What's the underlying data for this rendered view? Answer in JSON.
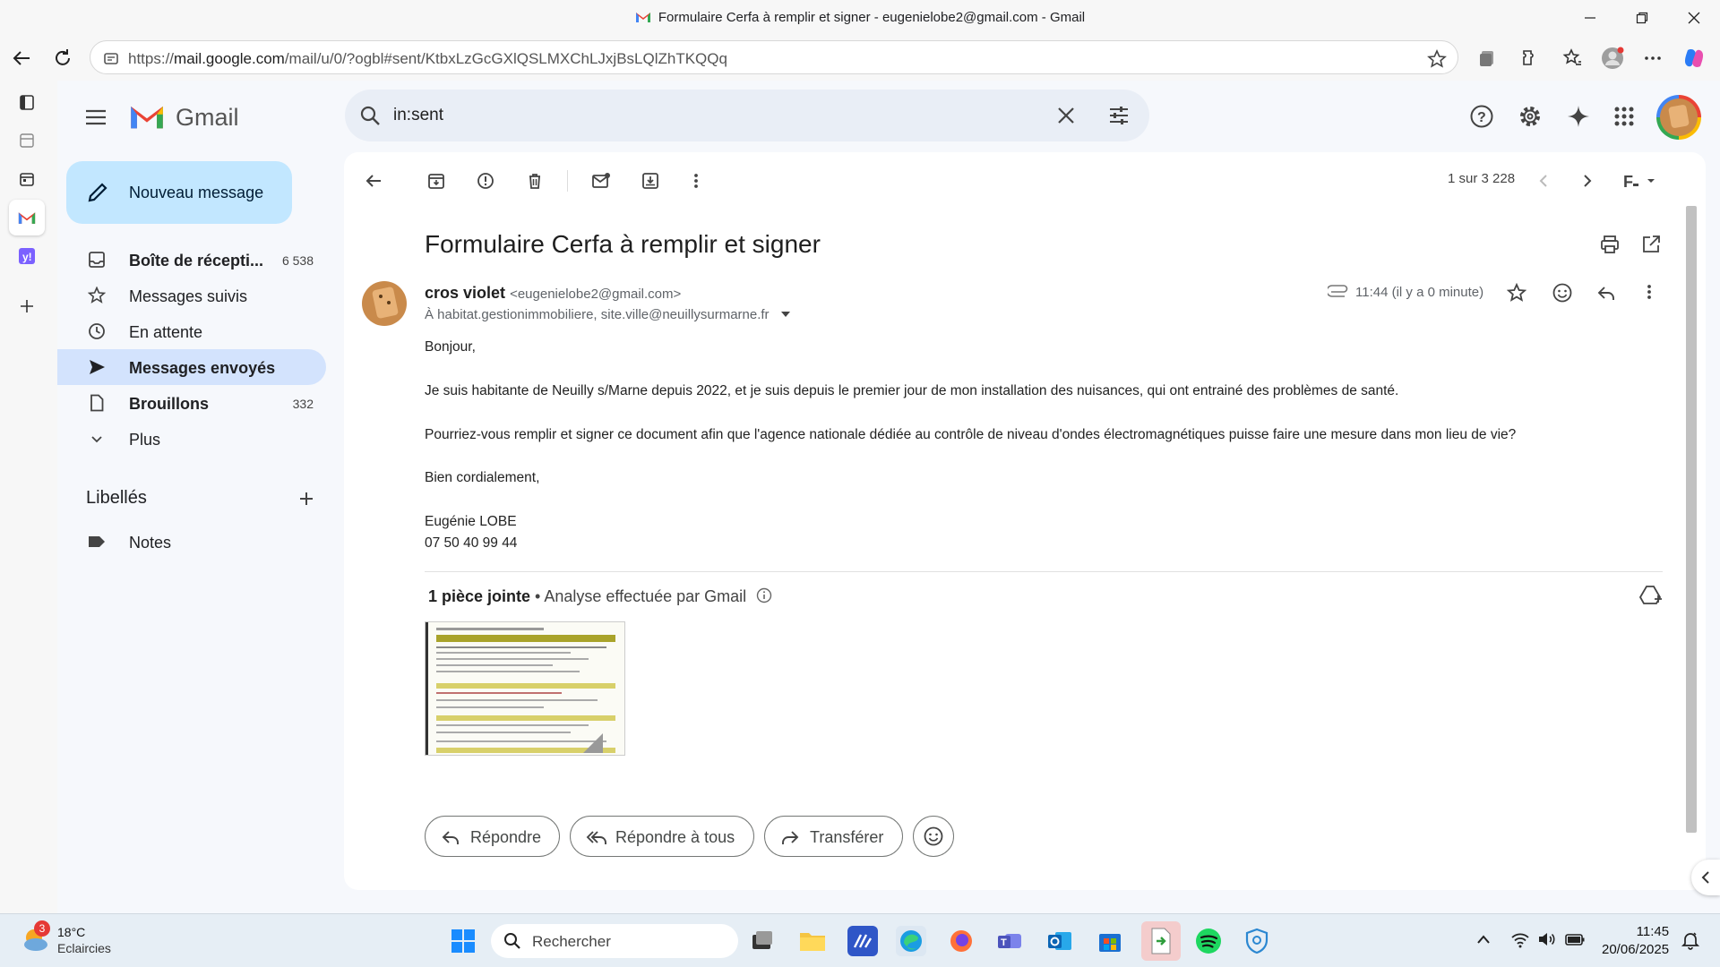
{
  "browser": {
    "window_title": "Formulaire Cerfa à remplir et signer - eugenielobe2@gmail.com - Gmail",
    "url_prefix": "https://",
    "url_domain": "mail.google.com",
    "url_rest": "/mail/u/0/?ogbl#sent/KtbxLzGcGXlQSLMXChLJxjBsLQlZhTKQQq"
  },
  "gmail": {
    "logo_text": "Gmail",
    "search_query": "in:sent",
    "compose_label": "Nouveau message",
    "nav": [
      {
        "label": "Boîte de récepti...",
        "count": "6 538"
      },
      {
        "label": "Messages suivis",
        "count": ""
      },
      {
        "label": "En attente",
        "count": ""
      },
      {
        "label": "Messages envoyés",
        "count": ""
      },
      {
        "label": "Brouillons",
        "count": "332"
      },
      {
        "label": "Plus",
        "count": ""
      }
    ],
    "labels_title": "Libellés",
    "labels": [
      {
        "label": "Notes"
      }
    ],
    "pager": "1 sur 3 228"
  },
  "email": {
    "subject": "Formulaire Cerfa à remplir et signer",
    "sender_name": "cros violet",
    "sender_email": "<eugenielobe2@gmail.com>",
    "recipients": "À habitat.gestionimmobiliere, site.ville@neuillysurmarne.fr",
    "time": "11:44 (il y a 0 minute)",
    "body": [
      "Bonjour,",
      "Je suis habitante de Neuilly s/Marne depuis 2022, et je suis depuis le premier jour de mon installation des nuisances, qui ont entrainé  des problèmes de santé.",
      "Pourriez-vous  remplir et signer ce document afin que l'agence nationale dédiée au contrôle de niveau d'ondes électromagnétiques puisse faire une mesure dans mon lieu de vie?",
      "Bien cordialement,",
      "Eugénie LOBE",
      "07 50 40 99 44"
    ],
    "attachments_count_label": "1 pièce jointe",
    "attachments_scan_label": " • Analyse effectuée par Gmail",
    "actions": {
      "reply": "Répondre",
      "reply_all": "Répondre à tous",
      "forward": "Transférer"
    }
  },
  "taskbar": {
    "weather_badge": "3",
    "weather_temp": "18°C",
    "weather_desc": "Eclaircies",
    "search_label": "Rechercher",
    "time": "11:45",
    "date": "20/06/2025"
  },
  "colors": {
    "compose_bg": "#c2e7ff",
    "active_nav_bg": "#d3e3fd",
    "search_bg": "#e9eef6",
    "gmail_red": "#ea4335"
  }
}
